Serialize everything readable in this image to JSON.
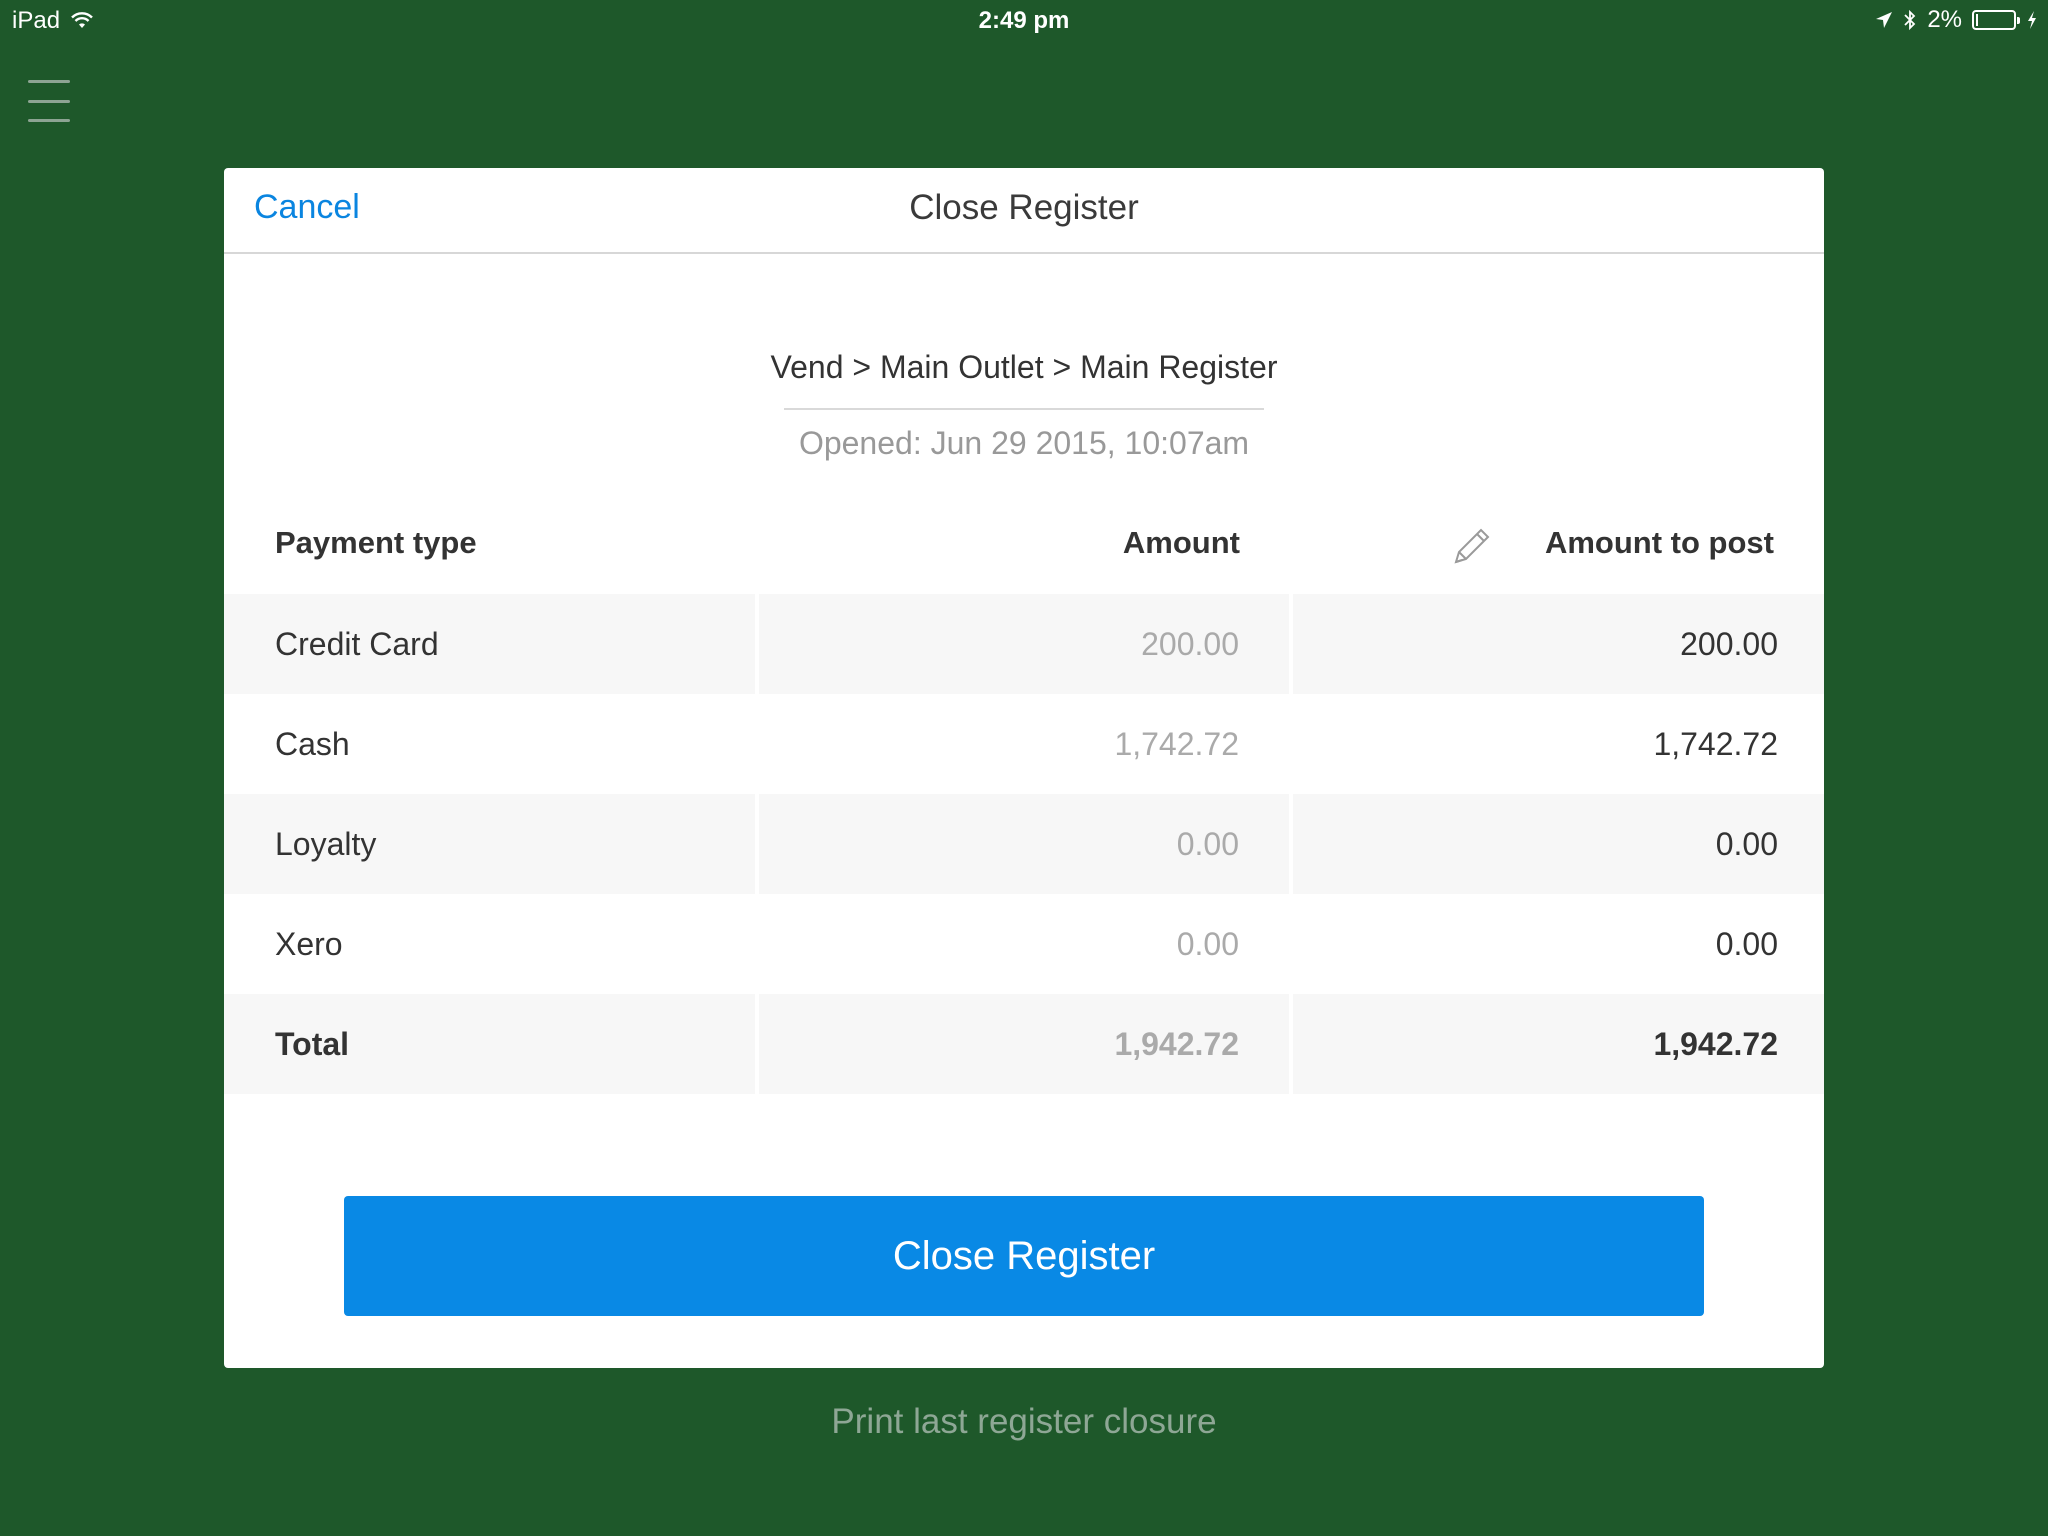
{
  "status_bar": {
    "device": "iPad",
    "time": "2:49 pm",
    "battery": "2%",
    "battery_level": 0.02
  },
  "modal": {
    "cancel_label": "Cancel",
    "title": "Close Register",
    "breadcrumb": "Vend > Main Outlet > Main Register",
    "opened": "Opened: Jun 29 2015, 10:07am"
  },
  "table": {
    "headers": {
      "payment_type": "Payment  type",
      "amount": "Amount",
      "amount_to_post": "Amount  to  post"
    },
    "rows": [
      {
        "name": "Credit Card",
        "amount": "200.00",
        "post": "200.00"
      },
      {
        "name": "Cash",
        "amount": "1,742.72",
        "post": "1,742.72"
      },
      {
        "name": "Loyalty",
        "amount": "0.00",
        "post": "0.00"
      },
      {
        "name": "Xero",
        "amount": "0.00",
        "post": "0.00"
      }
    ],
    "total": {
      "name": "Total",
      "amount": "1,942.72",
      "post": "1,942.72"
    }
  },
  "close_button_label": "Close Register",
  "print_link": "Print last register closure",
  "colors": {
    "background": "#1e582a",
    "accent": "#0989e5",
    "link": "#0a85e0"
  },
  "icons": [
    "menu-icon",
    "wifi-icon",
    "location-arrow-icon",
    "bluetooth-icon",
    "battery-icon",
    "charging-bolt-icon",
    "pencil-icon"
  ]
}
